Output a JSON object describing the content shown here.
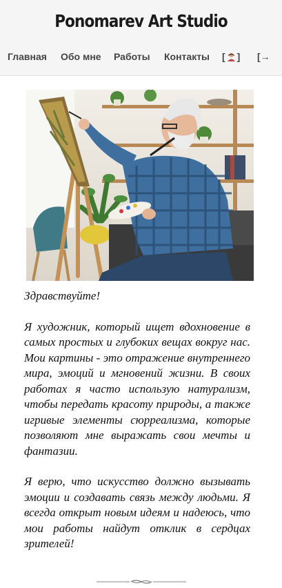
{
  "site": {
    "title": "Ponomarev Art Studio"
  },
  "nav": {
    "items": [
      {
        "label": "Главная"
      },
      {
        "label": "Обо мне"
      },
      {
        "label": "Работы"
      },
      {
        "label": "Контакты"
      }
    ],
    "avatar_open": "[",
    "avatar_close": "]",
    "login_label": "[→"
  },
  "icons": {
    "avatar": "user-avatar-icon",
    "login": "login-icon",
    "divider": "ornament-divider"
  },
  "content": {
    "greeting": "Здравствуйте!",
    "paragraph1": "Я художник, который ищет вдохновение в самых простых и глубоких вещах вокруг нас. Мои картины - это отражение внутреннего мира, эмоций и мгновений жизни. В своих работах я часто использую натурализм, чтобы передать красоту природы, а также игривые элементы сюрреализма, которые позволяют мне выражать свои мечты и фантазии.",
    "paragraph2": "Я верю, что искусство должно вызывать эмоции и создавать связь между людьми. Я всегда открыт новым идеям и надеюсь, что мои работы найдут отклик в сердцах зрителей!"
  },
  "colors": {
    "header_bg": "#f5f5f5",
    "title": "#1b1b1b",
    "nav_text": "#444444",
    "body_text": "#111111"
  }
}
